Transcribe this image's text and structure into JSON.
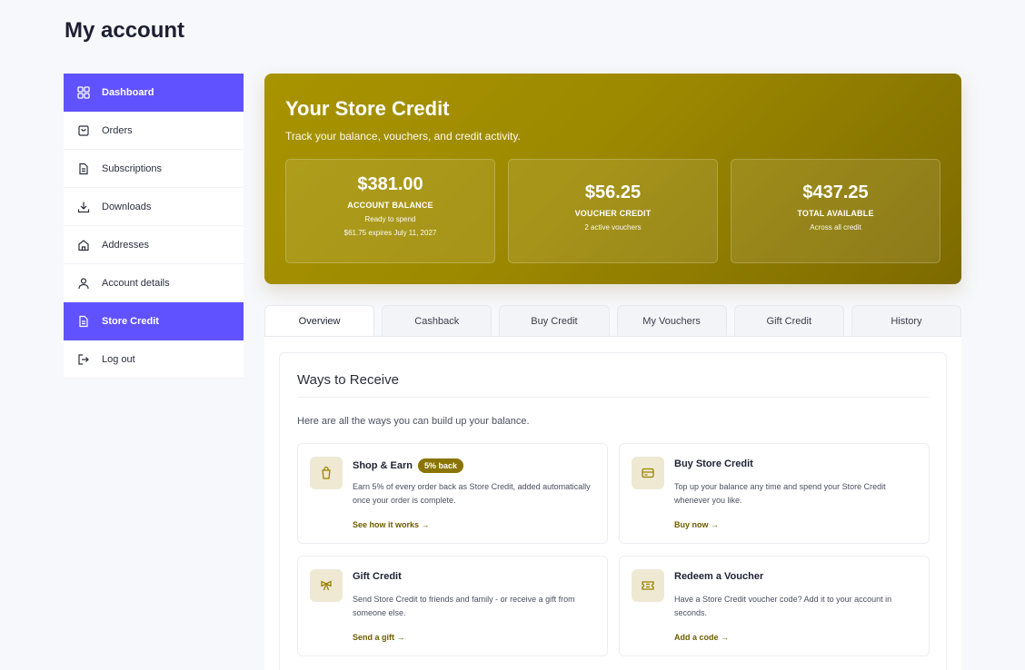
{
  "page": {
    "title": "My account"
  },
  "sidebar": {
    "items": [
      {
        "label": "Dashboard",
        "icon": "grid-icon",
        "active": true
      },
      {
        "label": "Orders",
        "icon": "bag-icon",
        "active": false
      },
      {
        "label": "Subscriptions",
        "icon": "document-icon",
        "active": false
      },
      {
        "label": "Downloads",
        "icon": "download-icon",
        "active": false
      },
      {
        "label": "Addresses",
        "icon": "home-icon",
        "active": false
      },
      {
        "label": "Account details",
        "icon": "user-icon",
        "active": false
      },
      {
        "label": "Store Credit",
        "icon": "document-icon",
        "active": true
      },
      {
        "label": "Log out",
        "icon": "logout-icon",
        "active": false
      }
    ]
  },
  "hero": {
    "title": "Your Store Credit",
    "subtitle": "Track your balance, vouchers, and credit activity.",
    "stats": [
      {
        "value": "$381.00",
        "label": "ACCOUNT BALANCE",
        "note1": "Ready to spend",
        "note2": "$61.75 expires July 11, 2027"
      },
      {
        "value": "$56.25",
        "label": "VOUCHER CREDIT",
        "note1": "2 active vouchers"
      },
      {
        "value": "$437.25",
        "label": "TOTAL AVAILABLE",
        "note1": "Across all credit"
      }
    ]
  },
  "tabs": [
    {
      "label": "Overview",
      "active": true
    },
    {
      "label": "Cashback",
      "active": false
    },
    {
      "label": "Buy Credit",
      "active": false
    },
    {
      "label": "My Vouchers",
      "active": false
    },
    {
      "label": "Gift Credit",
      "active": false
    },
    {
      "label": "History",
      "active": false
    }
  ],
  "ways": {
    "title": "Ways to Receive",
    "description": "Here are all the ways you can build up your balance.",
    "options": [
      {
        "title": "Shop & Earn",
        "badge": "5% back",
        "icon": "shopping-bag-icon",
        "text": "Earn 5% of every order back as Store Credit, added automatically once your order is complete.",
        "link": "See how it works →"
      },
      {
        "title": "Buy Store Credit",
        "icon": "credit-card-icon",
        "text": "Top up your balance any time and spend your Store Credit whenever you like.",
        "link": "Buy now →"
      },
      {
        "title": "Gift Credit",
        "icon": "gift-bow-icon",
        "text": "Send Store Credit to friends and family - or receive a gift from someone else.",
        "link": "Send a gift →"
      },
      {
        "title": "Redeem a Voucher",
        "icon": "ticket-icon",
        "text": "Have a Store Credit voucher code? Add it to your account in seconds.",
        "link": "Add a code →"
      }
    ]
  },
  "colors": {
    "accent": "#6152ff",
    "gold": "#a89400",
    "link": "#6e5c00",
    "badge": "#8a7400"
  }
}
